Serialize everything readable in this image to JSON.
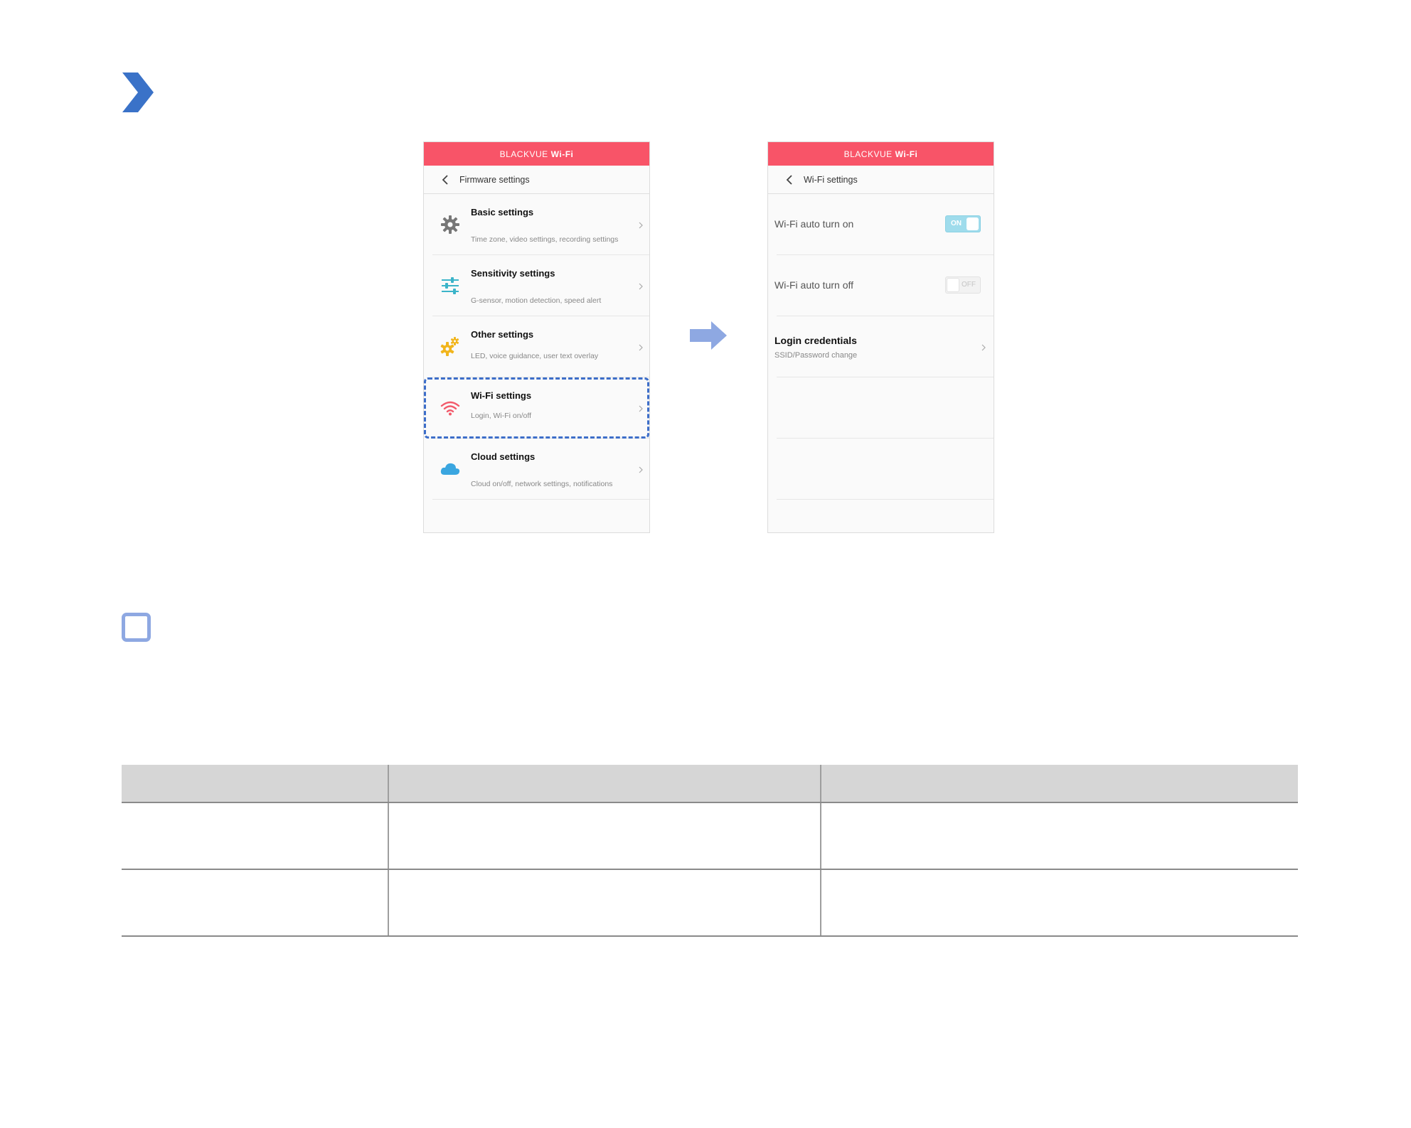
{
  "page": {
    "left_screen": {
      "app_bar": {
        "brand": "BLACKVUE",
        "suffix": "Wi-Fi"
      },
      "nav_title": "Firmware settings",
      "menu": [
        {
          "title": "Basic settings",
          "subtitle": "Time zone, video settings, recording settings",
          "icon": "gear-icon",
          "color": "#777777"
        },
        {
          "title": "Sensitivity settings",
          "subtitle": "G-sensor, motion detection, speed alert",
          "icon": "sliders-icon",
          "color": "#3bb4c9"
        },
        {
          "title": "Other settings",
          "subtitle": "LED, voice guidance, user text overlay",
          "icon": "gears-icon",
          "color": "#f1b51c"
        },
        {
          "title": "Wi-Fi settings",
          "subtitle": "Login, Wi-Fi on/off",
          "icon": "wifi-icon",
          "color": "#f25a6b"
        },
        {
          "title": "Cloud settings",
          "subtitle": "Cloud on/off, network settings, notifications",
          "icon": "cloud-icon",
          "color": "#3aa6e0"
        }
      ]
    },
    "right_screen": {
      "app_bar": {
        "brand": "BLACKVUE",
        "suffix": "Wi-Fi"
      },
      "nav_title": "Wi-Fi settings",
      "rows": [
        {
          "label": "Wi-Fi auto turn on",
          "toggle": "ON",
          "state": true
        },
        {
          "label": "Wi-Fi auto turn off",
          "toggle": "OFF",
          "state": false
        }
      ],
      "login": {
        "title": "Login credentials",
        "subtitle": "SSID/Password change"
      }
    },
    "colors": {
      "app_bar": "#f85468",
      "highlight": "#3d6ec9",
      "arrow": "#8ea8e2",
      "chevron_marker": "#3a72c8"
    }
  }
}
